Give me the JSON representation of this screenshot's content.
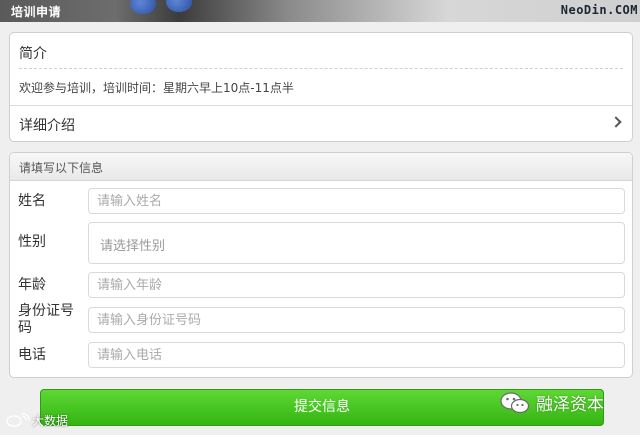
{
  "header": {
    "title": "培训申请",
    "watermark": "NeoDin.COM"
  },
  "intro": {
    "title": "简介",
    "text": "欢迎参与培训，培训时间：星期六早上10点-11点半",
    "detail_label": "详细介绍"
  },
  "form": {
    "section_title": "请填写以下信息",
    "fields": [
      {
        "label": "姓名",
        "placeholder": "请输入姓名"
      },
      {
        "label": "性别",
        "placeholder": "请选择性别"
      },
      {
        "label": "年龄",
        "placeholder": "请输入年龄"
      },
      {
        "label": "身份证号码",
        "placeholder": "请输入身份证号码"
      },
      {
        "label": "电话",
        "placeholder": "请输入电话"
      }
    ],
    "submit_label": "提交信息"
  },
  "overlays": {
    "wechat_text": "融泽资本",
    "weibo_text": "大数据"
  },
  "colors": {
    "accent": "#3dbd18",
    "header_bg": "#666666"
  }
}
